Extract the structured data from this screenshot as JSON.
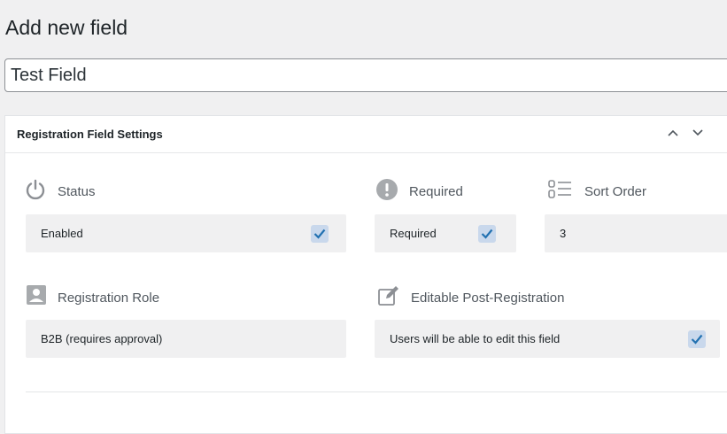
{
  "page": {
    "title": "Add new field"
  },
  "title_input": {
    "value": "Test Field"
  },
  "panel": {
    "title": "Registration Field Settings",
    "up_icon": "chevron-up-icon",
    "down_icon": "chevron-down-icon"
  },
  "fields": {
    "status": {
      "label": "Status",
      "icon": "power-icon",
      "value": "Enabled",
      "checked": true
    },
    "required": {
      "label": "Required",
      "icon": "exclamation-icon",
      "value": "Required",
      "checked": true
    },
    "sort_order": {
      "label": "Sort Order",
      "icon": "sort-numeric-icon",
      "value": "3"
    },
    "registration_role": {
      "label": "Registration Role",
      "icon": "user-card-icon",
      "value": "B2B (requires approval)"
    },
    "editable": {
      "label": "Editable Post-Registration",
      "icon": "edit-icon",
      "value": "Users will be able to edit this field",
      "checked": true
    }
  },
  "colors": {
    "check_fill": "#c9d8ec",
    "check_mark": "#2271b1",
    "icon_grey": "#8c8f94"
  }
}
